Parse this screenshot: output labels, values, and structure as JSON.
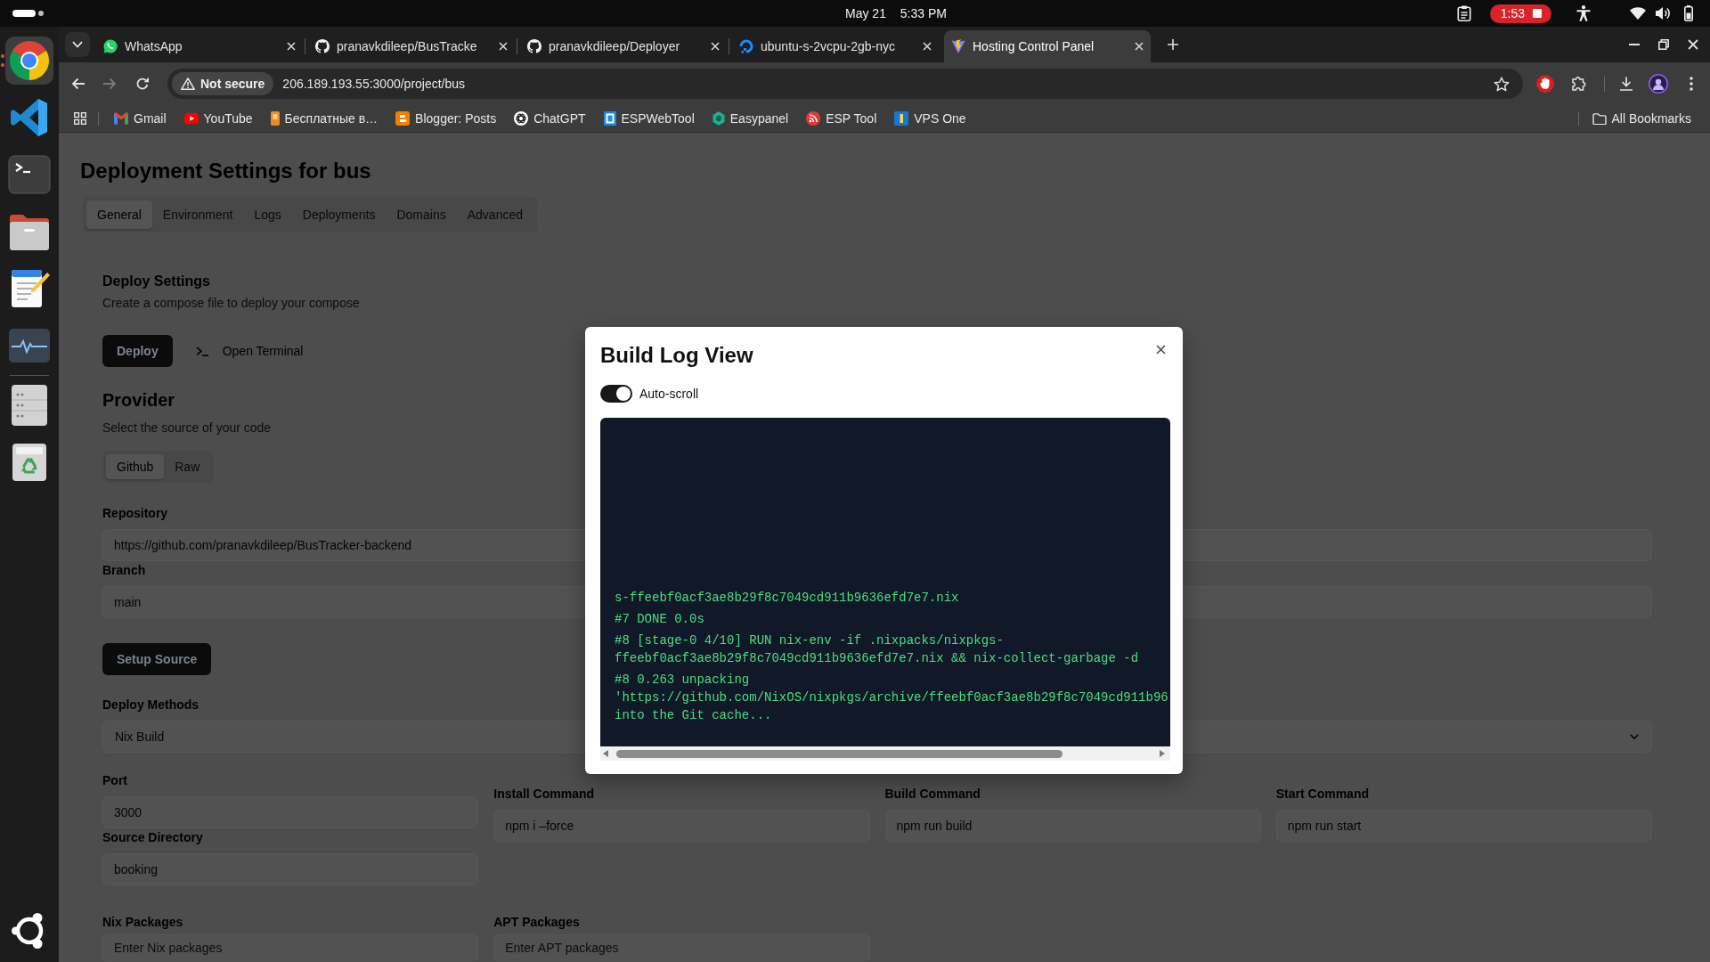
{
  "system_bar": {
    "date": "May 21",
    "time": "5:33 PM",
    "recording": "1:53"
  },
  "dock": {
    "items": [
      {
        "kind": "browser",
        "running": true
      },
      {
        "kind": "code",
        "running": false
      },
      {
        "kind": "terminal",
        "running": false
      },
      {
        "kind": "files",
        "running": false
      },
      {
        "kind": "notes",
        "running": false
      },
      {
        "kind": "monitor",
        "running": false
      },
      {
        "kind": "separator"
      },
      {
        "kind": "list",
        "running": false
      },
      {
        "kind": "trash",
        "running": false
      }
    ]
  },
  "browser": {
    "tabs": [
      {
        "title": "WhatsApp",
        "kind": "chat",
        "selected": false
      },
      {
        "title": "pranavkdileep/BusTracke",
        "kind": "github",
        "selected": false
      },
      {
        "title": "pranavkdileep/Deployer",
        "kind": "github",
        "selected": false
      },
      {
        "title": "ubuntu-s-2vcpu-2gb-nyc",
        "kind": "ring",
        "selected": false
      },
      {
        "title": "Hosting Control Panel",
        "kind": "bolt",
        "selected": true
      }
    ],
    "toolbar": {
      "nav": [
        {
          "kind": "back",
          "disabled": false
        },
        {
          "kind": "forward",
          "disabled": true
        },
        {
          "kind": "reload",
          "disabled": false
        }
      ],
      "security": "Not secure",
      "url": "206.189.193.55:3000/project/bus"
    },
    "bookmarks": [
      {
        "title": "Gmail",
        "kind": "mail"
      },
      {
        "title": "YouTube",
        "kind": "video"
      },
      {
        "title": "Бесплатные в…",
        "kind": "card"
      },
      {
        "title": "Blogger: Posts",
        "kind": "blog"
      },
      {
        "title": "ChatGPT",
        "kind": "knot"
      },
      {
        "title": "ESPWebTool",
        "kind": "tile"
      },
      {
        "title": "Easypanel",
        "kind": "hexagon"
      },
      {
        "title": "ESP Tool",
        "kind": "feed"
      },
      {
        "title": "VPS One",
        "kind": "bar-tile"
      }
    ],
    "all_bookmarks": "All Bookmarks"
  },
  "page": {
    "title": "Deployment Settings for bus",
    "tabs": [
      {
        "label": "General",
        "selected": true
      },
      {
        "label": "Environment",
        "selected": false
      },
      {
        "label": "Logs",
        "selected": false
      },
      {
        "label": "Deployments",
        "selected": false
      },
      {
        "label": "Domains",
        "selected": false
      },
      {
        "label": "Advanced",
        "selected": false
      }
    ],
    "deploy_settings": {
      "title": "Deploy Settings",
      "subtitle": "Create a compose file to deploy your compose",
      "buttons": [
        {
          "label": "Deploy",
          "kind": "primary"
        },
        {
          "label": "Open Terminal",
          "kind": "terminal"
        }
      ]
    },
    "provider": {
      "title": "Provider",
      "subtitle": "Select the source of your code",
      "tabs": [
        {
          "label": "Github",
          "selected": true
        },
        {
          "label": "Raw",
          "selected": false
        }
      ],
      "fields": [
        {
          "label": "Repository",
          "value": "https://github.com/pranavkdileep/BusTracker-backend"
        },
        {
          "label": "Branch",
          "value": "main"
        }
      ],
      "button": "Setup Source"
    },
    "build": {
      "deploy_method": {
        "label": "Deploy Methods",
        "value": "Nix Build"
      },
      "port": {
        "label": "Port",
        "value": "3000"
      },
      "source_directory": {
        "label": "Source Directory",
        "value": "booking"
      },
      "commands": [
        {
          "label": "Install Command",
          "value": "npm i –force"
        },
        {
          "label": "Build Command",
          "value": "npm run build"
        },
        {
          "label": "Start Command",
          "value": "npm run start"
        }
      ],
      "packages": [
        {
          "label": "Nix Packages",
          "placeholder": "Enter Nix packages"
        },
        {
          "label": "APT Packages",
          "placeholder": "Enter APT packages"
        }
      ]
    }
  },
  "modal": {
    "title": "Build Log View",
    "auto_scroll": {
      "label": "Auto-scroll",
      "on": true
    },
    "log": [
      {
        "lines": [
          "s-ffeebf0acf3ae8b29f8c7049cd911b9636efd7e7.nix"
        ]
      },
      {
        "lines": [
          "#7 DONE 0.0s"
        ]
      },
      {
        "lines": [
          "#8 [stage-0 4/10] RUN nix-env -if .nixpacks/nixpkgs-",
          "ffeebf0acf3ae8b29f8c7049cd911b9636efd7e7.nix && nix-collect-garbage -d"
        ]
      },
      {
        "lines": [
          "#8 0.263 unpacking",
          "'https://github.com/NixOS/nixpkgs/archive/ffeebf0acf3ae8b29f8c7049cd911b96",
          "into the Git cache..."
        ]
      }
    ]
  }
}
